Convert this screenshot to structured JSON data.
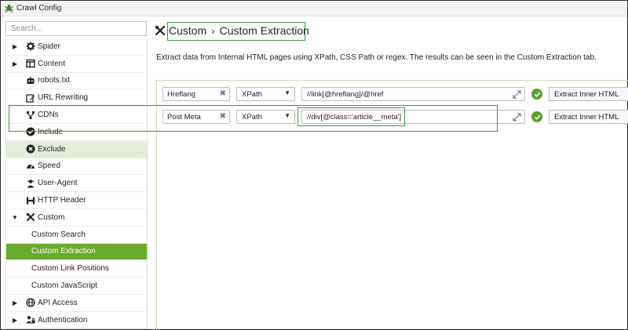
{
  "window": {
    "title": "Crawl Config",
    "app_icon": "spider-icon"
  },
  "sidebar": {
    "search_placeholder": "Search...",
    "items": [
      {
        "label": "Spider",
        "icon": "gear-icon",
        "caret": "▶",
        "level": "top",
        "state": ""
      },
      {
        "label": "Content",
        "icon": "content-icon",
        "caret": "▶",
        "level": "top",
        "state": ""
      },
      {
        "label": "robots.txt",
        "icon": "robot-icon",
        "caret": "",
        "level": "top",
        "state": ""
      },
      {
        "label": "URL Rewriting",
        "icon": "edit-icon",
        "caret": "",
        "level": "top",
        "state": ""
      },
      {
        "label": "CDNs",
        "icon": "network-icon",
        "caret": "",
        "level": "top",
        "state": ""
      },
      {
        "label": "Include",
        "icon": "check-circle-icon",
        "caret": "",
        "level": "top",
        "state": ""
      },
      {
        "label": "Exclude",
        "icon": "x-circle-icon",
        "caret": "",
        "level": "top",
        "state": "hover"
      },
      {
        "label": "Speed",
        "icon": "speedometer-icon",
        "caret": "",
        "level": "top",
        "state": ""
      },
      {
        "label": "User-Agent",
        "icon": "user-agent-icon",
        "caret": "",
        "level": "top",
        "state": ""
      },
      {
        "label": "HTTP Header",
        "icon": "header-icon",
        "caret": "",
        "level": "top",
        "state": ""
      },
      {
        "label": "Custom",
        "icon": "tools-icon",
        "caret": "▼",
        "level": "top",
        "state": ""
      },
      {
        "label": "Custom Search",
        "icon": "",
        "caret": "",
        "level": "sub",
        "state": ""
      },
      {
        "label": "Custom Extraction",
        "icon": "",
        "caret": "",
        "level": "sub",
        "state": "active"
      },
      {
        "label": "Custom Link Positions",
        "icon": "",
        "caret": "",
        "level": "sub",
        "state": ""
      },
      {
        "label": "Custom JavaScript",
        "icon": "",
        "caret": "",
        "level": "sub",
        "state": ""
      },
      {
        "label": "API Access",
        "icon": "globe-icon",
        "caret": "▶",
        "level": "top",
        "state": ""
      },
      {
        "label": "Authentication",
        "icon": "users-lock-icon",
        "caret": "▶",
        "level": "top",
        "state": ""
      }
    ]
  },
  "main": {
    "heading": {
      "section": "Custom",
      "separator": "›",
      "page": "Custom Extraction",
      "icon": "tools-icon"
    },
    "description": "Extract data from Internal HTML pages using XPath, CSS Path or regex. The results can be seen in the Custom Extraction tab.",
    "extractors": [
      {
        "name": "Hreflang",
        "type": "XPath",
        "expression": "//link[@hreflang]/@href",
        "valid": true,
        "extract": "Extract Inner HTML"
      },
      {
        "name": "Post Meta",
        "type": "XPath",
        "expression": "//div[@class='article__meta']",
        "valid": true,
        "extract": "Extract Inner HTML"
      }
    ]
  },
  "colors": {
    "accent": "#6aab2e",
    "hover": "#e4edd9",
    "highlight": "#3d9a3d",
    "status_ok": "#5aa02c"
  }
}
